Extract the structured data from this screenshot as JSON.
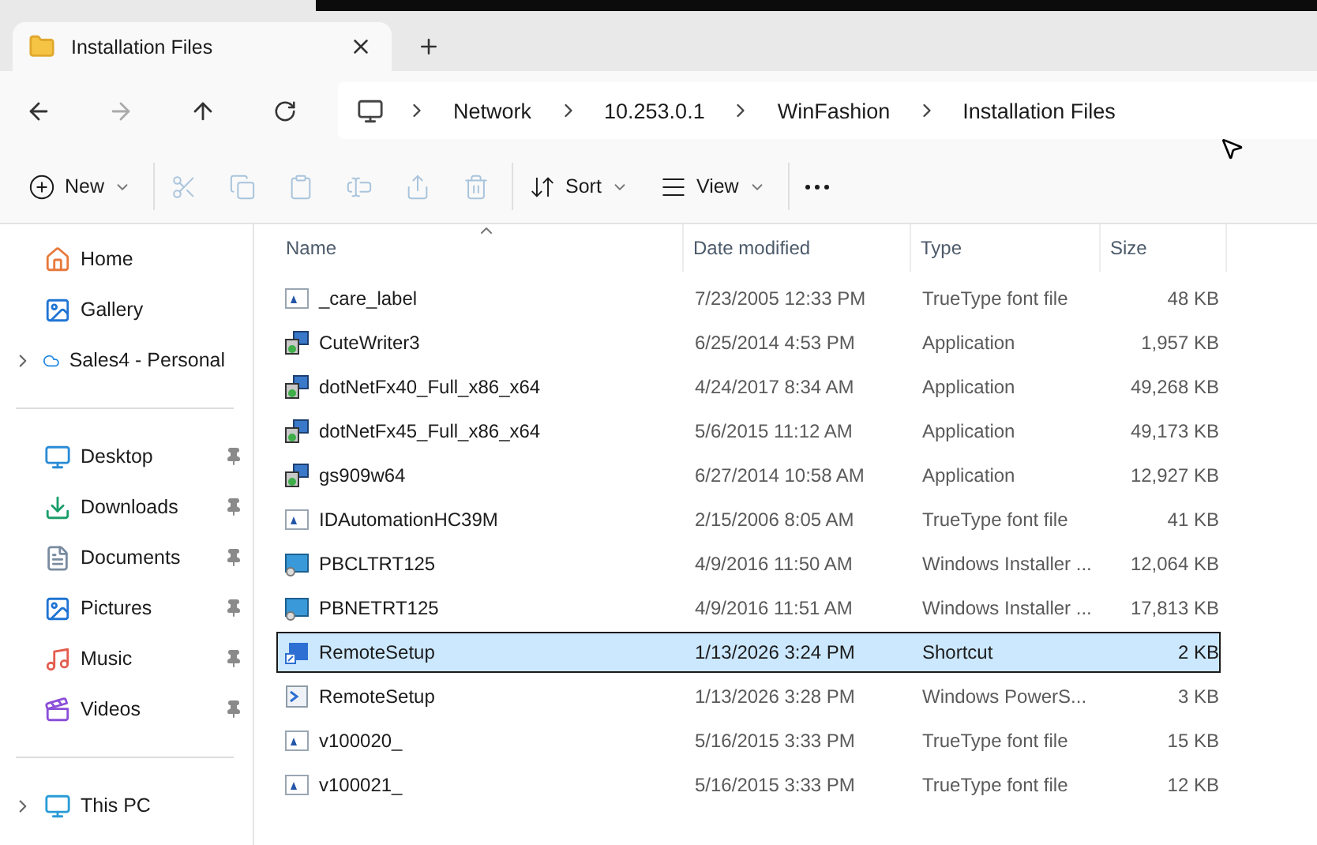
{
  "tabs": [
    {
      "label": "Installation Files",
      "selected": true
    }
  ],
  "breadcrumb": [
    "Network",
    "10.253.0.1",
    "WinFashion",
    "Installation Files"
  ],
  "toolbar": [
    [
      {
        "kind": "new",
        "label": "New",
        "disabled": false,
        "dropdown": true
      }
    ],
    [
      {
        "kind": "cut",
        "disabled": true,
        "dropdown": false
      },
      {
        "kind": "copy",
        "disabled": true,
        "dropdown": false
      },
      {
        "kind": "paste",
        "disabled": true,
        "dropdown": false
      },
      {
        "kind": "rename",
        "disabled": true,
        "dropdown": false
      },
      {
        "kind": "share",
        "disabled": true,
        "dropdown": false
      },
      {
        "kind": "delete",
        "disabled": true,
        "dropdown": false
      }
    ],
    [
      {
        "kind": "sort",
        "label": "Sort",
        "disabled": false,
        "dropdown": true
      },
      {
        "kind": "view",
        "label": "View",
        "disabled": false,
        "dropdown": true
      }
    ],
    [
      {
        "kind": "more",
        "disabled": false,
        "dropdown": false
      }
    ]
  ],
  "sidebar": {
    "sections": [
      [
        {
          "kind": "home",
          "label": "Home",
          "pinned": false,
          "expandable": false
        },
        {
          "kind": "gallery",
          "label": "Gallery",
          "pinned": false,
          "expandable": false
        },
        {
          "kind": "cloud",
          "label": "Sales4 - Personal",
          "pinned": false,
          "expandable": true
        }
      ],
      [
        {
          "kind": "desktop",
          "label": "Desktop",
          "pinned": true,
          "expandable": false
        },
        {
          "kind": "downloads",
          "label": "Downloads",
          "pinned": true,
          "expandable": false
        },
        {
          "kind": "documents",
          "label": "Documents",
          "pinned": true,
          "expandable": false
        },
        {
          "kind": "pictures",
          "label": "Pictures",
          "pinned": true,
          "expandable": false
        },
        {
          "kind": "music",
          "label": "Music",
          "pinned": true,
          "expandable": false
        },
        {
          "kind": "videos",
          "label": "Videos",
          "pinned": true,
          "expandable": false
        }
      ],
      [
        {
          "kind": "pc",
          "label": "This PC",
          "pinned": false,
          "expandable": true
        }
      ]
    ]
  },
  "table": {
    "columns": [
      {
        "label": "Name",
        "sorted": true
      },
      {
        "label": "Date modified",
        "sorted": false
      },
      {
        "label": "Type",
        "sorted": false
      },
      {
        "label": "Size",
        "sorted": false
      }
    ],
    "rows": [
      {
        "kind": "font",
        "name": "_care_label",
        "date": "7/23/2005 12:33 PM",
        "type": "TrueType font file",
        "size": "48 KB",
        "selected": false
      },
      {
        "kind": "app",
        "name": "CuteWriter3",
        "date": "6/25/2014 4:53 PM",
        "type": "Application",
        "size": "1,957 KB",
        "selected": false
      },
      {
        "kind": "app",
        "name": "dotNetFx40_Full_x86_x64",
        "date": "4/24/2017 8:34 AM",
        "type": "Application",
        "size": "49,268 KB",
        "selected": false
      },
      {
        "kind": "app",
        "name": "dotNetFx45_Full_x86_x64",
        "date": "5/6/2015 11:12 AM",
        "type": "Application",
        "size": "49,173 KB",
        "selected": false
      },
      {
        "kind": "app",
        "name": "gs909w64",
        "date": "6/27/2014 10:58 AM",
        "type": "Application",
        "size": "12,927 KB",
        "selected": false
      },
      {
        "kind": "font",
        "name": "IDAutomationHC39M",
        "date": "2/15/2006 8:05 AM",
        "type": "TrueType font file",
        "size": "41 KB",
        "selected": false
      },
      {
        "kind": "installer",
        "name": "PBCLTRT125",
        "date": "4/9/2016 11:50 AM",
        "type": "Windows Installer ...",
        "size": "12,064 KB",
        "selected": false
      },
      {
        "kind": "installer",
        "name": "PBNETRT125",
        "date": "4/9/2016 11:51 AM",
        "type": "Windows Installer ...",
        "size": "17,813 KB",
        "selected": false
      },
      {
        "kind": "shortcut",
        "name": "RemoteSetup",
        "date": "1/13/2026 3:24 PM",
        "type": "Shortcut",
        "size": "2 KB",
        "selected": true
      },
      {
        "kind": "script",
        "name": "RemoteSetup",
        "date": "1/13/2026 3:28 PM",
        "type": "Windows PowerS...",
        "size": "3 KB",
        "selected": false
      },
      {
        "kind": "font",
        "name": "v100020_",
        "date": "5/16/2015 3:33 PM",
        "type": "TrueType font file",
        "size": "15 KB",
        "selected": false
      },
      {
        "kind": "font",
        "name": "v100021_",
        "date": "5/16/2015 3:33 PM",
        "type": "TrueType font file",
        "size": "12 KB",
        "selected": false
      }
    ]
  }
}
